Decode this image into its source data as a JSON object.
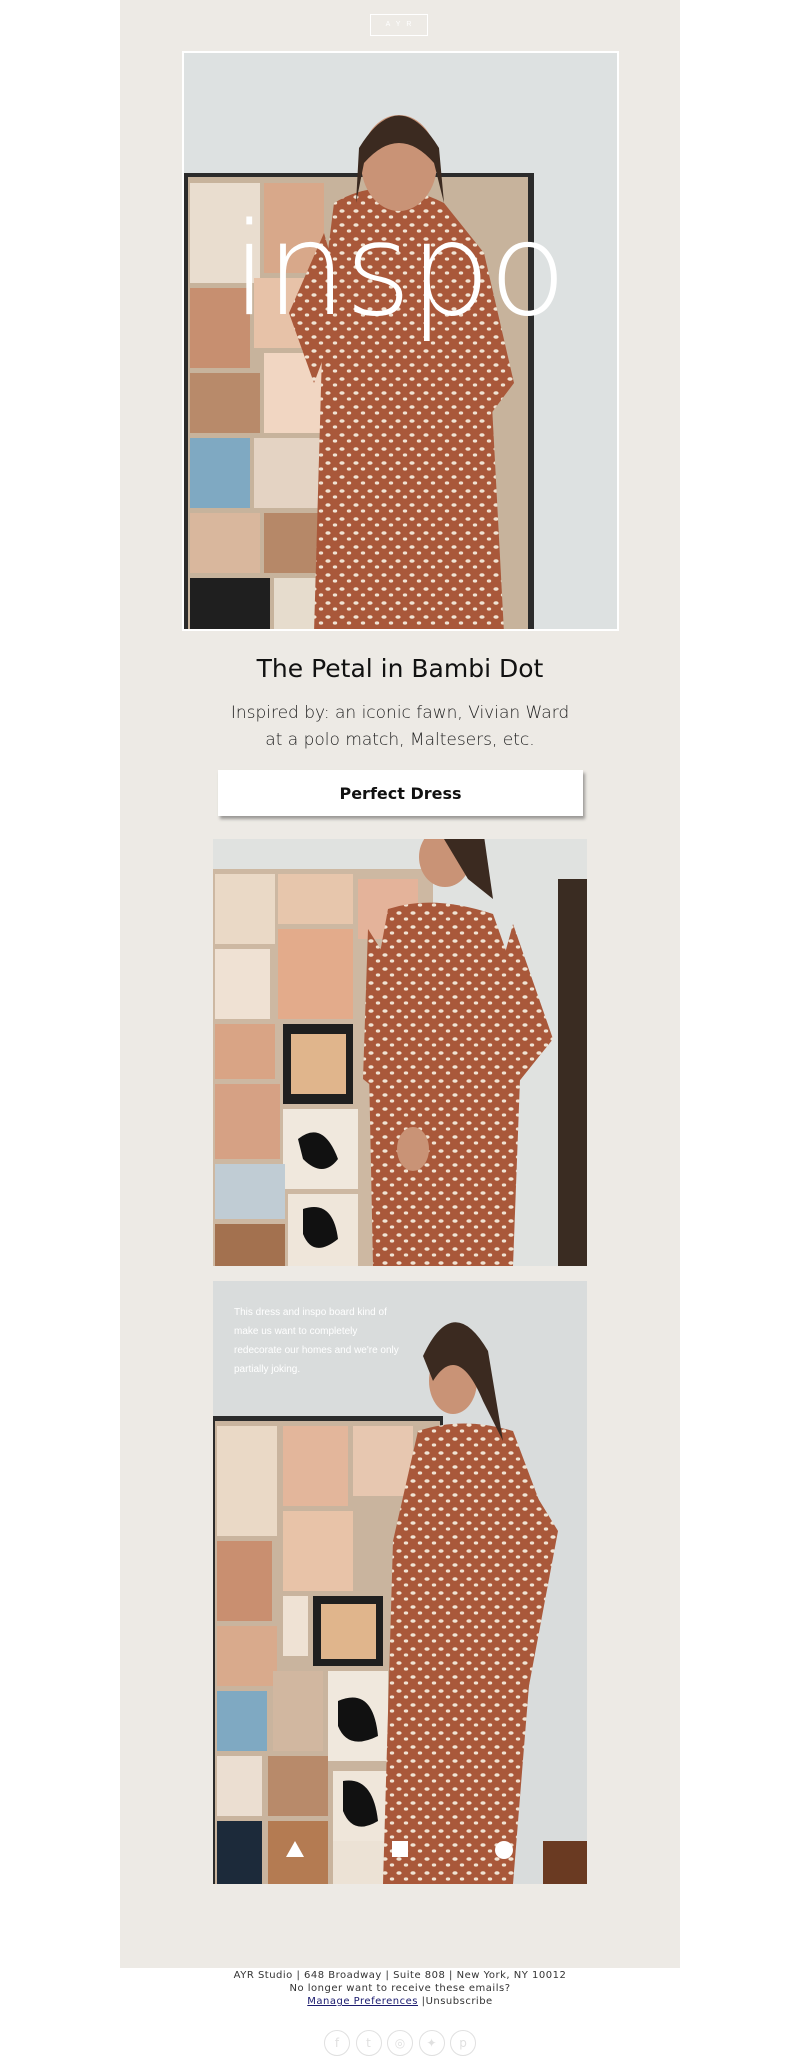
{
  "header": {
    "logo_text": "AYR"
  },
  "hero": {
    "overlay_text": "inspo"
  },
  "product": {
    "title": "The Petal in Bambi Dot",
    "subtitle": "Inspired by: an iconic fawn, Vivian Ward at a polo match, Maltesers, etc.",
    "cta_label": "Perfect Dress"
  },
  "photo3": {
    "caption": "This dress and inspo board kind of make us want to completely redecorate our homes and we're only partially joking."
  },
  "shape_icons": [
    "triangle-icon",
    "square-icon",
    "circle-icon"
  ],
  "footer": {
    "address": "AYR Studio | 648 Broadway | Suite 808 | New York, NY 10012",
    "no_longer": "No longer want to receive these emails?",
    "manage_label": "Manage Preferences",
    "separator": " |",
    "unsubscribe_label": "Unsubscribe"
  },
  "social": [
    {
      "icon": "facebook-icon",
      "glyph": "f"
    },
    {
      "icon": "tumblr-icon",
      "glyph": "t"
    },
    {
      "icon": "instagram-icon",
      "glyph": "◎"
    },
    {
      "icon": "twitter-icon",
      "glyph": "✦"
    },
    {
      "icon": "pinterest-icon",
      "glyph": "p"
    }
  ],
  "colors": {
    "background": "#edeae5",
    "dress": "#a9583a",
    "dots": "#f0e3d3",
    "white": "#ffffff"
  }
}
